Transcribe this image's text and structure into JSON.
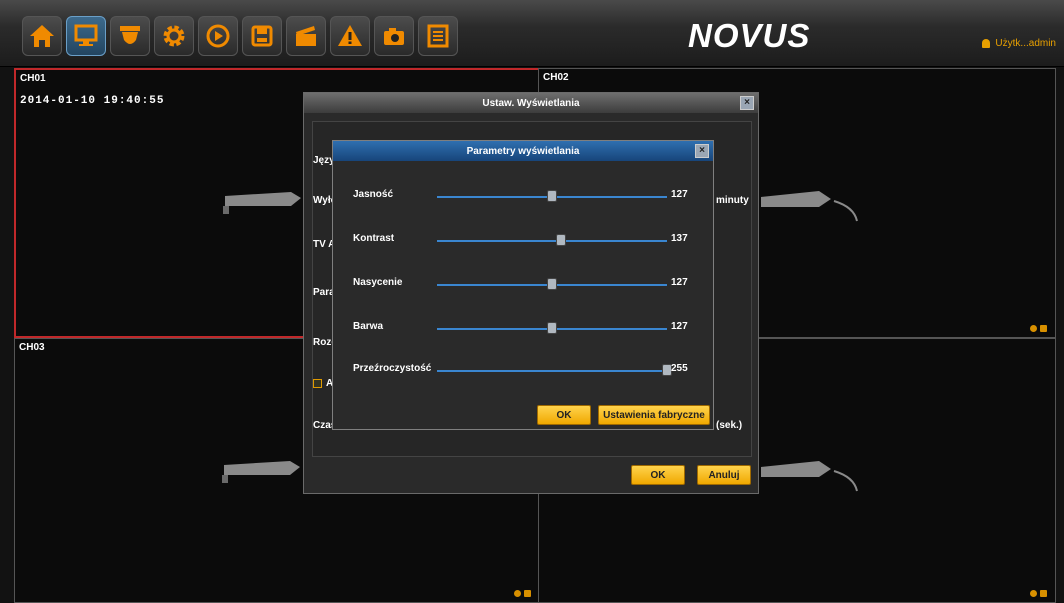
{
  "toolbar": {
    "icons": [
      "home-icon",
      "monitor-icon",
      "camera-icon",
      "gear-icon",
      "playback-icon",
      "save-icon",
      "clapper-icon",
      "alarm-icon",
      "snapshot-icon",
      "list-icon"
    ]
  },
  "brand": {
    "logo": "NOVUS"
  },
  "user": {
    "label": "Użytk...admin"
  },
  "channels": [
    {
      "label": "CH01",
      "timestamp": "2014-01-10 19:40:55"
    },
    {
      "label": "CH02"
    },
    {
      "label": "CH03"
    },
    {
      "label": "CH04"
    }
  ],
  "outer_dialog": {
    "title": "Ustaw. Wyświetlania",
    "labels": [
      "Języ",
      "Wyło",
      "TV A",
      "Para",
      "Rozd",
      "A",
      "Czas"
    ],
    "suffix_minutes": "minuty",
    "suffix_seconds": "(sek.)",
    "ok_label": "OK",
    "cancel_label": "Anuluj"
  },
  "inner_dialog": {
    "title": "Parametry wyświetlania",
    "sliders": [
      {
        "label": "Jasność",
        "value": "127",
        "fraction": 0.498
      },
      {
        "label": "Kontrast",
        "value": "137",
        "fraction": 0.537
      },
      {
        "label": "Nasycenie",
        "value": "127",
        "fraction": 0.498
      },
      {
        "label": "Barwa",
        "value": "127",
        "fraction": 0.498
      },
      {
        "label": "Przeźroczystość",
        "value": "255",
        "fraction": 1.0
      }
    ],
    "ok_label": "OK",
    "defaults_label": "Ustawienia fabryczne"
  },
  "colors": {
    "accent": "#f0a800",
    "selected_border": "#c0282a",
    "slider": "#3a86d0"
  }
}
